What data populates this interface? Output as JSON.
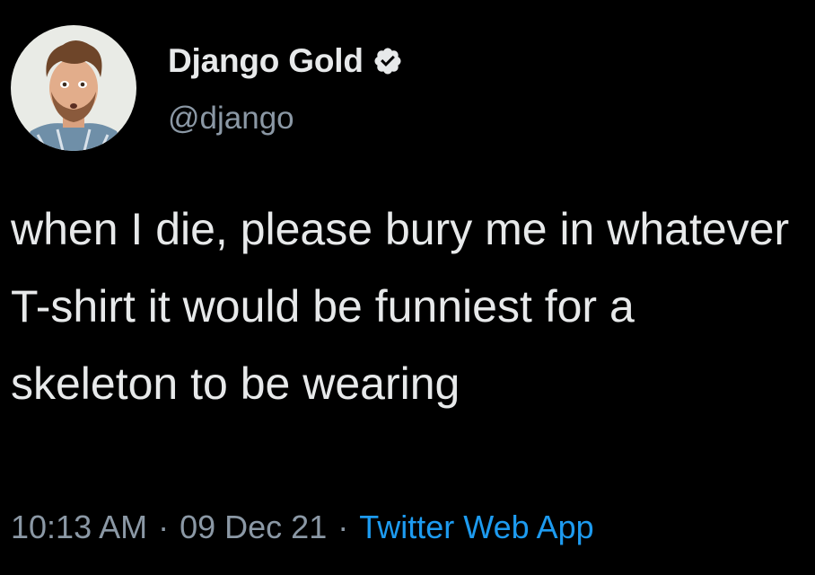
{
  "user": {
    "display_name": "Django Gold",
    "handle": "@django",
    "verified_icon": "verified-badge-icon",
    "avatar_icon": "profile-avatar"
  },
  "tweet": {
    "text": "when I die, please bury me in whatever T-shirt it would be funniest for a skeleton to be wearing"
  },
  "meta": {
    "time": "10:13 AM",
    "separator": "·",
    "date": "09 Dec 21",
    "source": "Twitter Web App"
  },
  "colors": {
    "background": "#000000",
    "primary_text": "#e7e9ea",
    "secondary_text": "#8b98a5",
    "link": "#1d9bf0"
  }
}
